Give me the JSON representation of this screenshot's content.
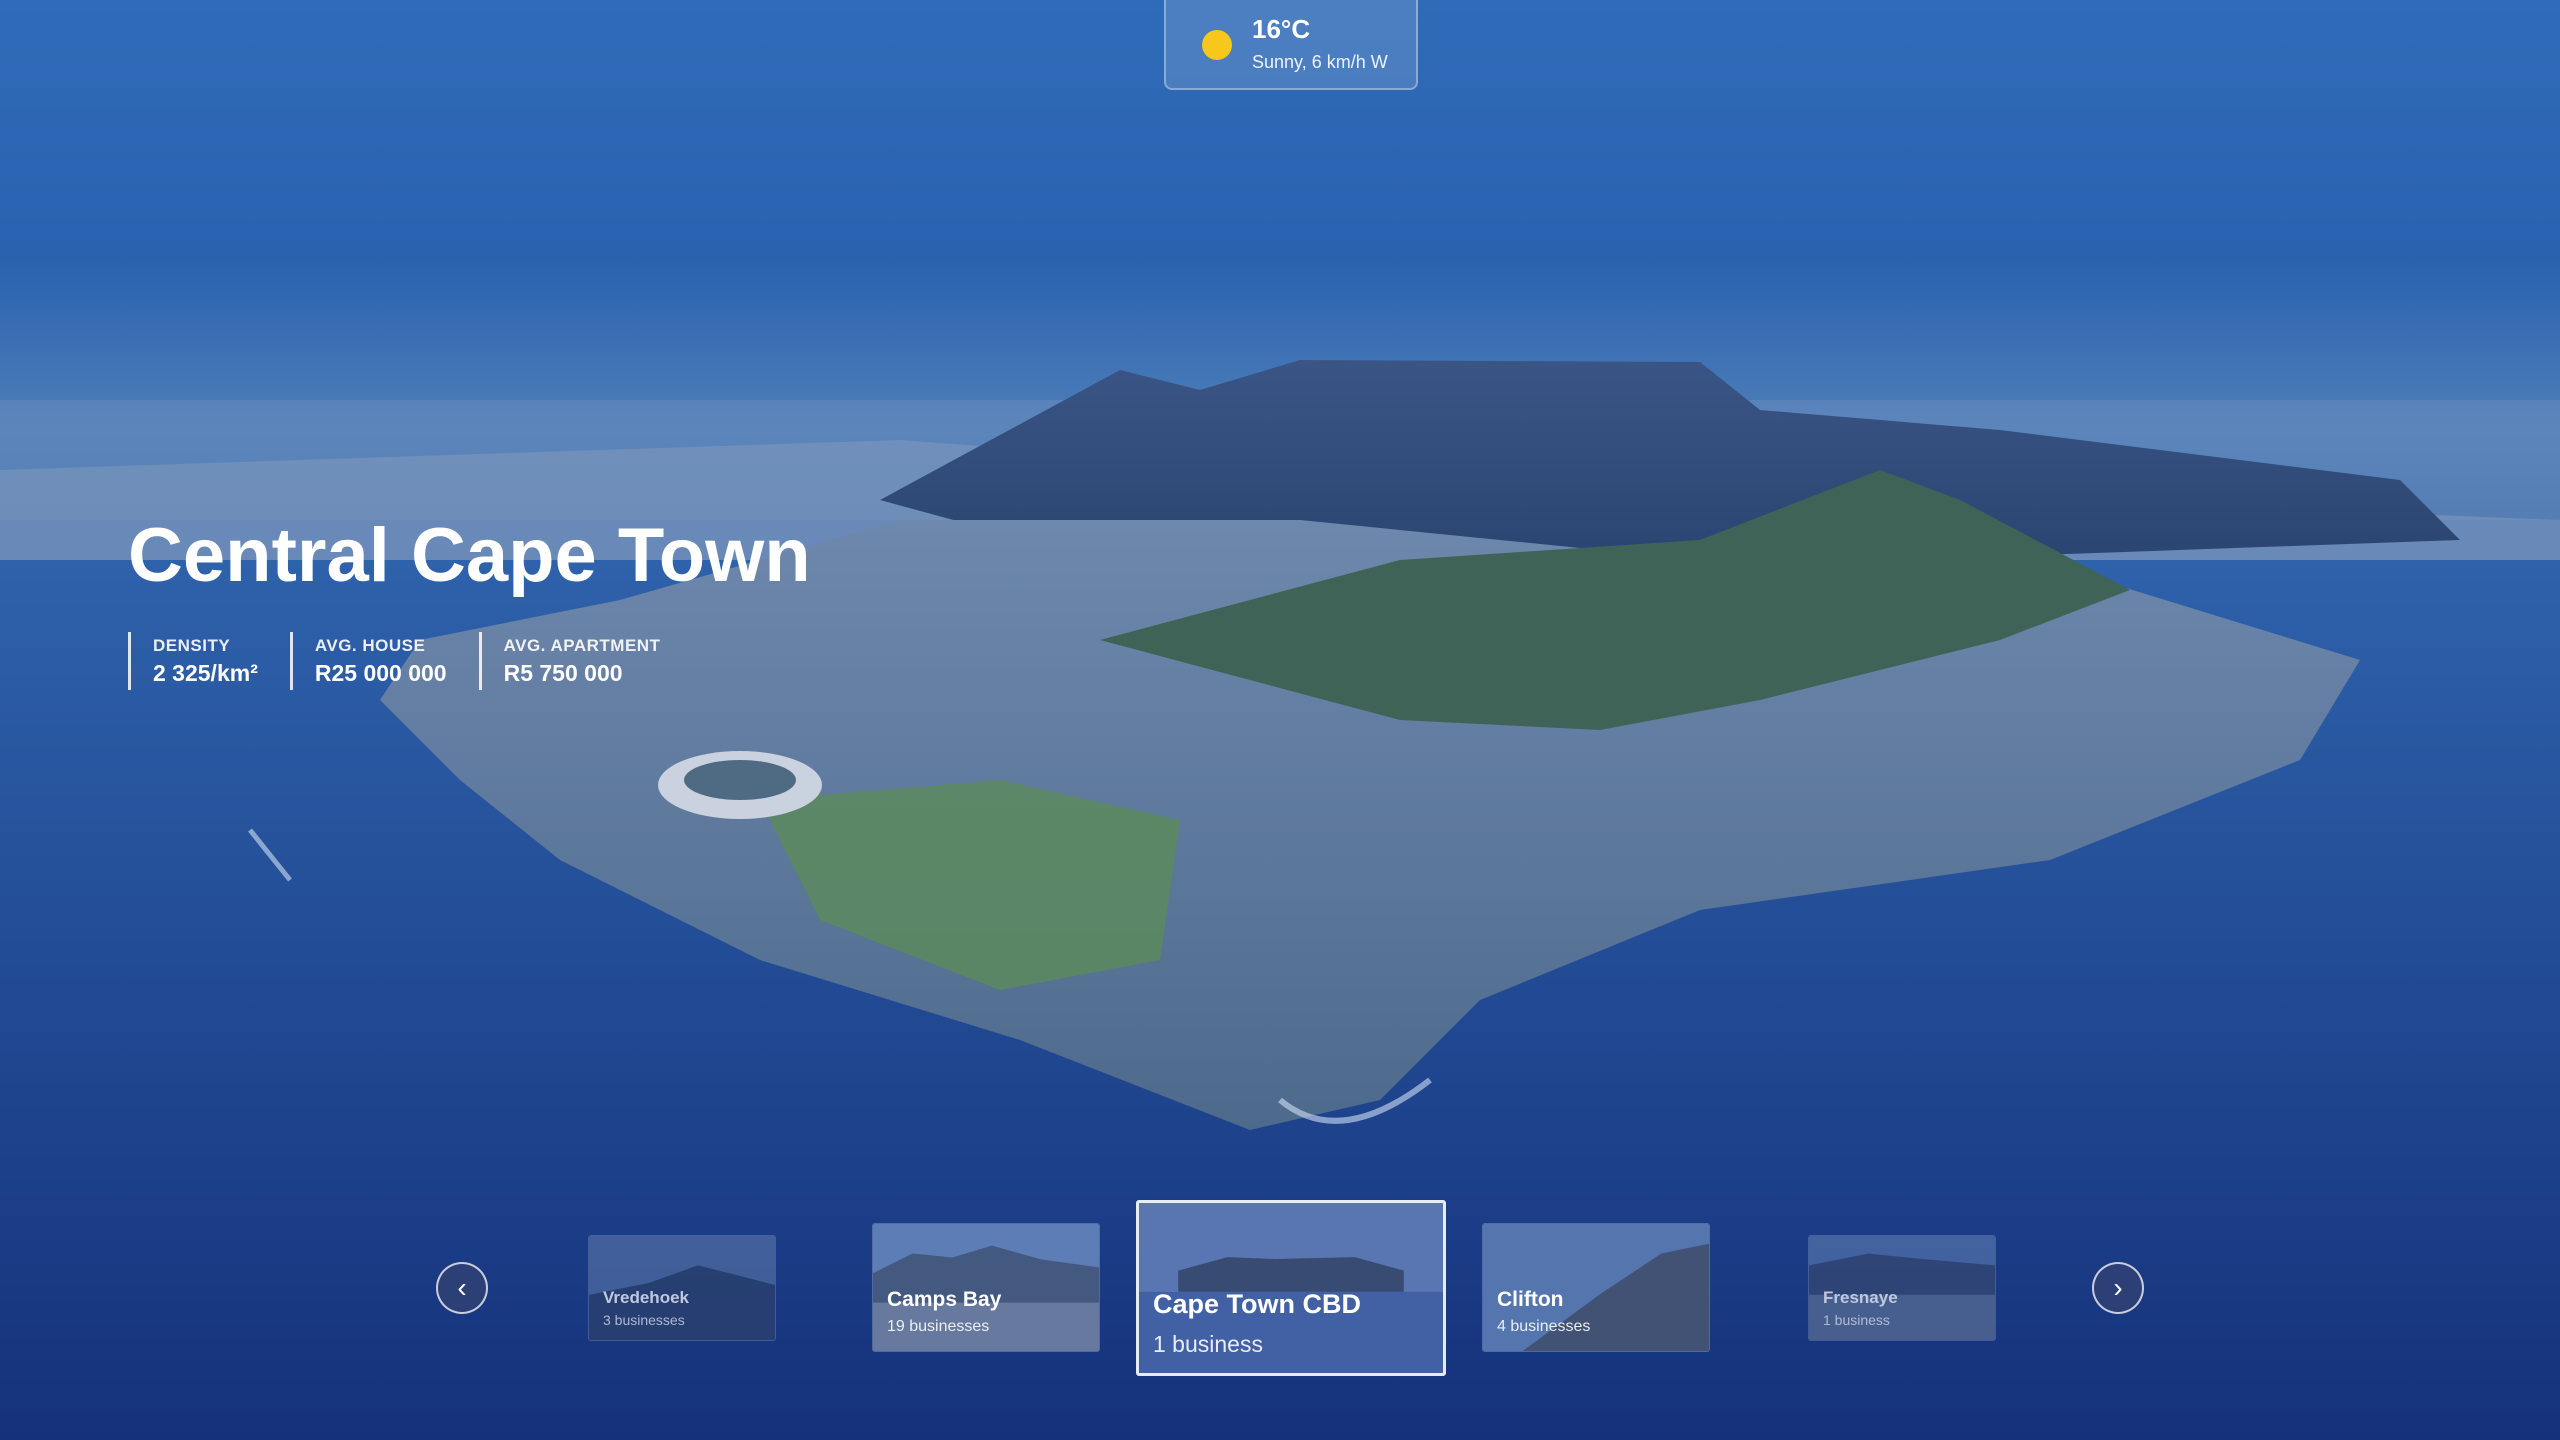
{
  "weather": {
    "temperature": "16°C",
    "condition": "Sunny, 6 km/h W",
    "icon": "sun-icon",
    "sun_color": "#f7c71b"
  },
  "region": {
    "title": "Central Cape Town",
    "stats": [
      {
        "label": "DENSITY",
        "value": "2 325/km²"
      },
      {
        "label": "AVG. HOUSE",
        "value": "R25 000 000"
      },
      {
        "label": "AVG. APARTMENT",
        "value": "R5 750 000"
      }
    ]
  },
  "carousel": {
    "prev_icon": "chevron-left-icon",
    "next_icon": "chevron-right-icon",
    "prev_glyph": "‹",
    "next_glyph": "›",
    "items": [
      {
        "name": "Vredehoek",
        "count": "3 businesses"
      },
      {
        "name": "Camps Bay",
        "count": "19 businesses"
      },
      {
        "name": "Cape Town CBD",
        "count": "1 business",
        "active": true
      },
      {
        "name": "Clifton",
        "count": "4 businesses"
      },
      {
        "name": "Fresnaye",
        "count": "1 business"
      }
    ]
  }
}
